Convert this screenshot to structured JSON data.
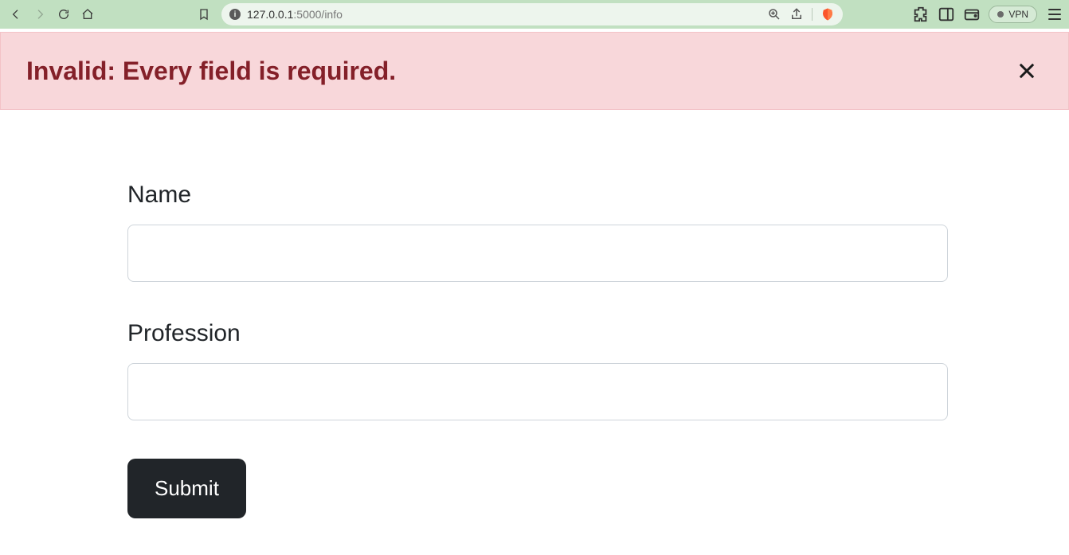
{
  "browser": {
    "url_host": "127.0.0.1",
    "url_path": ":5000/info",
    "vpn_label": "VPN"
  },
  "alert": {
    "message": "Invalid: Every field is required."
  },
  "form": {
    "name_label": "Name",
    "name_value": "",
    "profession_label": "Profession",
    "profession_value": "",
    "submit_label": "Submit"
  }
}
